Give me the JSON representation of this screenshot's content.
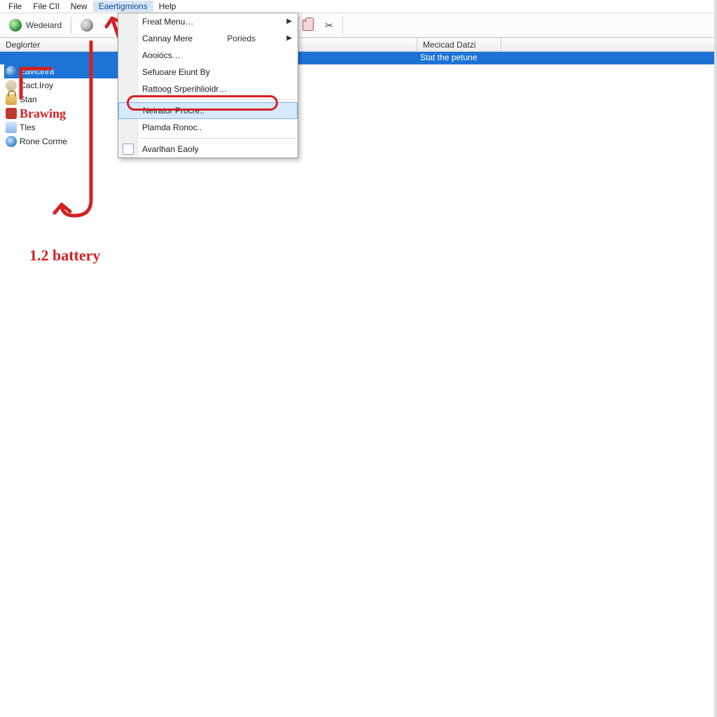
{
  "menu": {
    "items": [
      "File",
      "File Cīl",
      "New",
      "Eaertigmions",
      "Help"
    ],
    "active_index": 3
  },
  "toolbar": {
    "btn1_label": "Wedeiard"
  },
  "columns": {
    "col1": "Deglorter",
    "col2": "Mecicad Datzi"
  },
  "selected_row": {
    "col2": "Stat the petune"
  },
  "tree": {
    "items": [
      {
        "label": "Eavlcinra",
        "icon": "world",
        "selected": true
      },
      {
        "label": "Cact.Iroy",
        "icon": "group"
      },
      {
        "label": "Stan",
        "icon": "lock"
      },
      {
        "label": "Brawing",
        "icon": "car",
        "anno": true
      },
      {
        "label": "Tles",
        "icon": "folder"
      },
      {
        "label": "Rone Corme",
        "icon": "disc"
      }
    ]
  },
  "dropdown": {
    "items": [
      {
        "label": "Freat Menu…",
        "submenu": true
      },
      {
        "label": "Cannay Mere",
        "sub_label": "Porieds",
        "submenu": true
      },
      {
        "label": "Aooiócs…"
      },
      {
        "label": "Sefuoare Eiunt By"
      },
      {
        "label": "Rattoog Srperihlioldr…"
      },
      {
        "sep": true
      },
      {
        "label": "Neirator Procre..",
        "highlight": true
      },
      {
        "label": "Plamda Ronoc.."
      },
      {
        "sep": true
      },
      {
        "label": "Avarlhan Eaoly",
        "icon": "cal"
      }
    ]
  },
  "annotations": {
    "line2_label": "1.2 battery"
  },
  "colors": {
    "accent": "#1e74d6",
    "anno_red": "#d42020"
  }
}
